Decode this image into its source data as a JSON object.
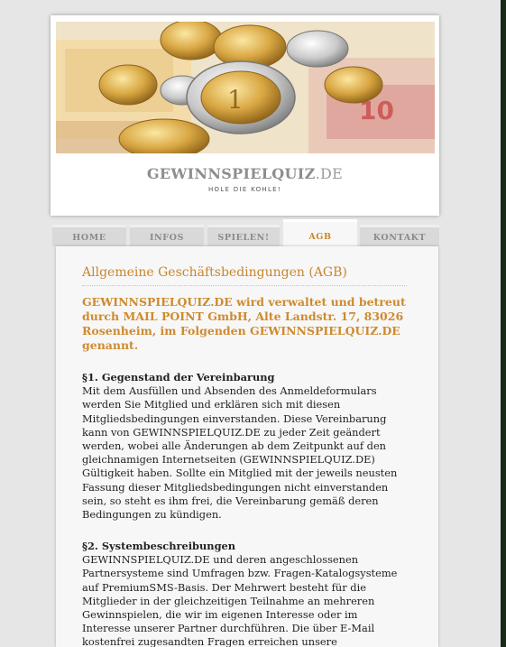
{
  "header": {
    "logo_main": "GEWINNSPIELQUIZ",
    "logo_tld": ".DE",
    "tagline": "HOLE DIE KOHLE!"
  },
  "nav": {
    "tabs": [
      {
        "label": "HOME"
      },
      {
        "label": "INFOS"
      },
      {
        "label": "SPIELEN!"
      },
      {
        "label": "AGB"
      },
      {
        "label": "KONTAKT"
      }
    ],
    "active": "AGB"
  },
  "main": {
    "title": "Allgemeine Geschäftsbedingungen (AGB)",
    "intro": "GEWINNSPIELQUIZ.DE wird verwaltet und betreut durch MAIL POINT GmbH, Alte Landstr. 17, 83026 Rosenheim, im Folgenden GEWINNSPIELQUIZ.DE genannt.",
    "sections": [
      {
        "title": "§1. Gegenstand der Vereinbarung",
        "body": "Mit dem Ausfüllen und Absenden des Anmeldeformulars werden Sie Mitglied und erklären sich mit diesen Mitgliedsbedingungen einverstanden. Diese Vereinbarung kann von GEWINNSPIELQUIZ.DE zu jeder Zeit geändert werden, wobei alle Änderungen ab dem Zeitpunkt auf den gleichnamigen Internetseiten (GEWINNSPIELQUIZ.DE) Gültigkeit haben. Sollte ein Mitglied mit der jeweils neusten Fassung dieser Mitgliedsbedingungen nicht einverstanden sein, so steht es ihm frei, die Vereinbarung gemäß deren Bedingungen zu kündigen."
      },
      {
        "title": "§2. Systembeschreibungen",
        "body": "GEWINNSPIELQUIZ.DE und deren angeschlossenen Partnersysteme sind Umfragen bzw. Fragen-Katalogsysteme auf PremiumSMS-Basis. Der Mehrwert besteht für die Mitglieder in der gleichzeitigen Teilnahme an mehreren Gewinnspielen, die wir im eigenen Interesse oder im Interesse unserer Partner durchführen. Die über E-Mail kostenfrei zugesandten Fragen erreichen unsere Auftraggeber im Sinne der"
      }
    ]
  },
  "colors": {
    "accent": "#c8862d",
    "background": "#e6e6e6",
    "panel": "#f7f7f7"
  }
}
